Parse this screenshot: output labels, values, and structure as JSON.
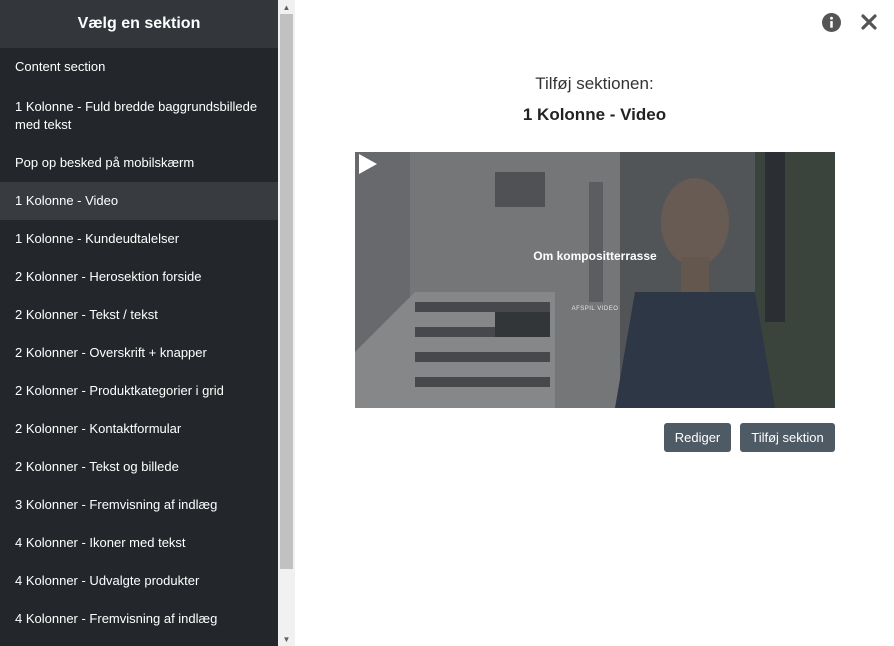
{
  "sidebar": {
    "title": "Vælg en sektion",
    "items": [
      {
        "label": "Content section"
      },
      {
        "label": "1 Kolonne - Fuld bredde baggrundsbillede med tekst"
      },
      {
        "label": "Pop op besked på mobilskærm"
      },
      {
        "label": "1 Kolonne - Video"
      },
      {
        "label": "1 Kolonne - Kundeudtalelser"
      },
      {
        "label": "2 Kolonner - Herosektion forside"
      },
      {
        "label": "2 Kolonner - Tekst / tekst"
      },
      {
        "label": "2 Kolonner - Overskrift + knapper"
      },
      {
        "label": "2 Kolonner - Produktkategorier i grid"
      },
      {
        "label": "2 Kolonner - Kontaktformular"
      },
      {
        "label": "2 Kolonner - Tekst og billede"
      },
      {
        "label": "3 Kolonner - Fremvisning af indlæg"
      },
      {
        "label": "4 Kolonner - Ikoner med tekst"
      },
      {
        "label": "4 Kolonner - Udvalgte produkter"
      },
      {
        "label": "4 Kolonner - Fremvisning af indlæg"
      }
    ],
    "active_index": 3
  },
  "main": {
    "add_label": "Tilføj sektionen:",
    "section_name": "1 Kolonne - Video",
    "preview": {
      "video_title": "Om kompositterrasse",
      "play_label": "AFSPIL VIDEO"
    },
    "buttons": {
      "edit_label": "Rediger",
      "add_label": "Tilføj sektion"
    }
  },
  "icons": {
    "info": "info-icon",
    "close": "close-icon",
    "play": "play-icon"
  },
  "colors": {
    "sidebar_bg": "#23272b",
    "sidebar_header_bg": "#33373c",
    "sidebar_active_bg": "#383c41",
    "button_bg": "#4e5a64",
    "icon_color": "#555555"
  }
}
